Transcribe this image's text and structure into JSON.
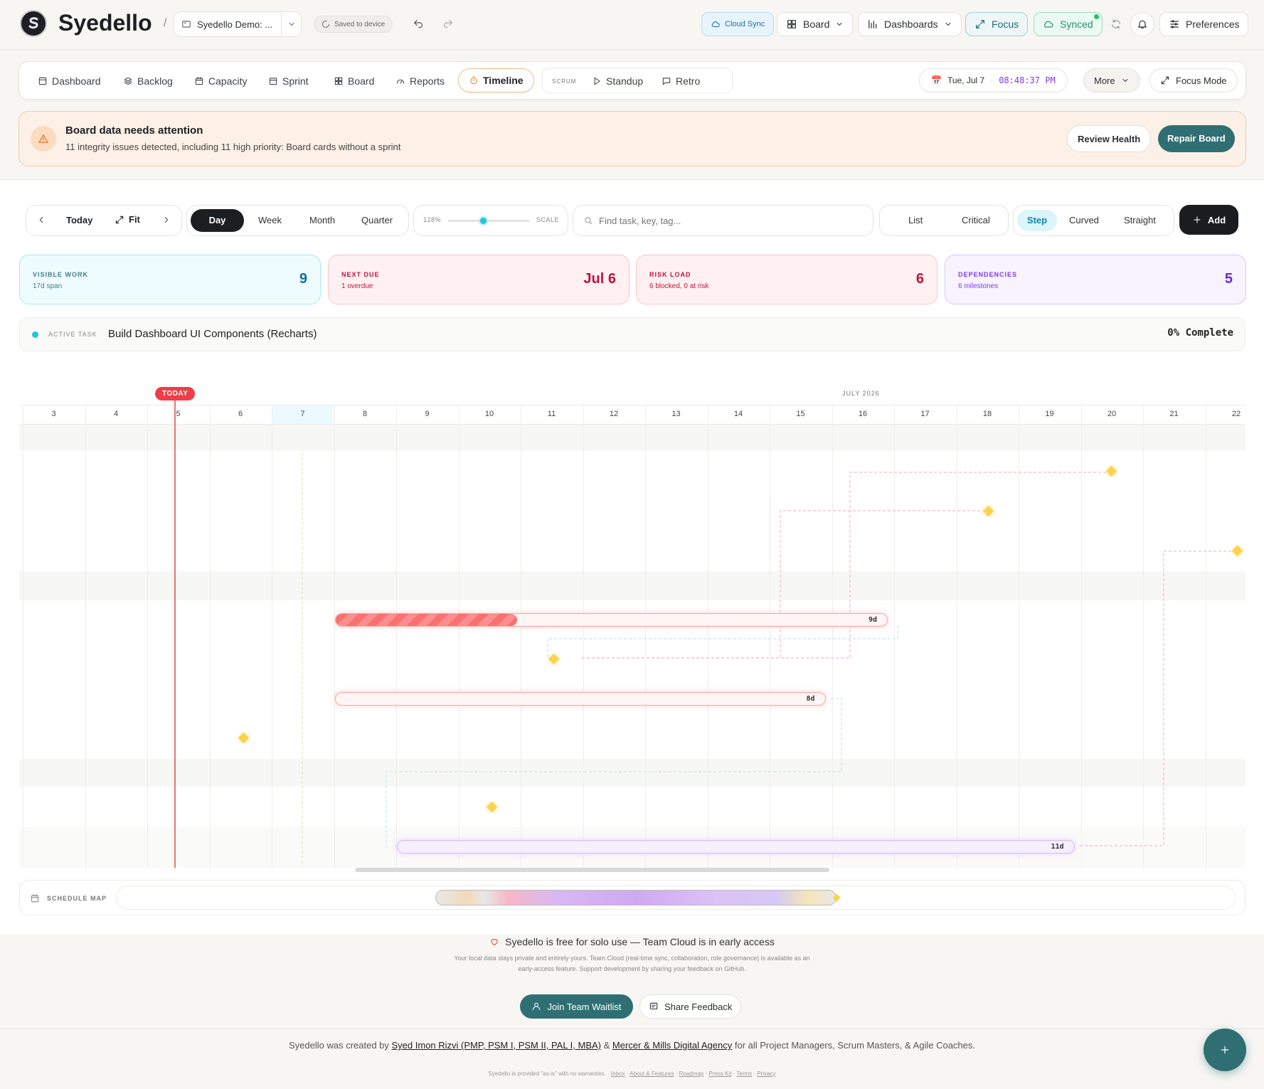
{
  "app": {
    "name": "Syedello",
    "project": "Syedello Demo: ...",
    "saved": "Saved to device"
  },
  "topbar": {
    "cloud_sync": "Cloud Sync",
    "board": "Board",
    "dashboards": "Dashboards",
    "focus": "Focus",
    "synced": "Synced",
    "preferences": "Preferences"
  },
  "nav": {
    "items": [
      "Dashboard",
      "Backlog",
      "Capacity",
      "Sprint",
      "Board",
      "Reports",
      "Timeline"
    ],
    "active": "Timeline",
    "scrum_label": "SCRUM",
    "scrum_items": [
      "Standup",
      "Retro"
    ],
    "date": "Tue, Jul 7",
    "time": "08:48:37 PM",
    "more": "More",
    "focus_mode": "Focus Mode"
  },
  "alert": {
    "title": "Board data needs attention",
    "text": "11 integrity issues detected, including 11 high priority: Board cards without a sprint",
    "review": "Review Health",
    "repair": "Repair Board"
  },
  "toolbar": {
    "today": "Today",
    "fit": "Fit",
    "scales": [
      "Day",
      "Week",
      "Month",
      "Quarter"
    ],
    "active_scale": "Day",
    "zoom": "128%",
    "zoom_value": 0.43,
    "scale_label": "SCALE",
    "search_placeholder": "Find task, key, tag...",
    "views": [
      "List",
      "Critical"
    ],
    "lines": [
      "Step",
      "Curved",
      "Straight"
    ],
    "active_line": "Step",
    "add": "Add"
  },
  "kpis": [
    {
      "label": "VISIBLE WORK",
      "sub": "17d span",
      "value": "9",
      "color": "#0e7490"
    },
    {
      "label": "NEXT DUE",
      "sub": "1 overdue",
      "value": "Jul 6",
      "color": "#be123c"
    },
    {
      "label": "RISK LOAD",
      "sub": "6 blocked, 0 at risk",
      "value": "6",
      "color": "#be123c"
    },
    {
      "label": "DEPENDENCIES",
      "sub": "6 milestones",
      "value": "5",
      "color": "#6d28d9"
    }
  ],
  "active_task": {
    "label": "ACTIVE TASK",
    "title": "Build Dashboard UI Components (Recharts)",
    "complete": "0% Complete"
  },
  "timeline": {
    "today_badge": "TODAY",
    "month": "JULY 2026",
    "days": [
      "3",
      "4",
      "5",
      "6",
      "7",
      "8",
      "9",
      "10",
      "11",
      "12",
      "13",
      "14",
      "15",
      "16",
      "17",
      "18",
      "19",
      "20",
      "21",
      "22"
    ],
    "bars": [
      {
        "start": 8,
        "end": 16,
        "label": "9d",
        "progress": 0.33
      },
      {
        "start": 8,
        "end": 15,
        "label": "8d",
        "progress": 0
      },
      {
        "start": 9,
        "end": 19,
        "label": "11d",
        "progress": 0
      }
    ]
  },
  "schedule_map": {
    "label": "SCHEDULE MAP"
  },
  "footer": {
    "headline": "Syedello is free for solo use — Team Cloud is in early access",
    "body1": "Your local data stays private and entirely yours. Team Cloud (real-time sync, collaboration, role governance) is available as an",
    "body2": "early-access feature. Support development by sharing your feedback on GitHub.",
    "waitlist": "Join Team Waitlist",
    "feedback": "Share Feedback",
    "credit_pre": "Syedello was created by ",
    "credit_name": "Syed Imon Rizvi (PMP, PSM I, PSM II, PAL I, MBA)",
    "credit_amp": " & ",
    "credit_agency": "Mercer & Mills Digital Agency",
    "credit_post": " for all Project Managers, Scrum Masters, & Agile Coaches.",
    "disclaimer": "Syedello is provided \"as-is\" with no warranties.",
    "links": [
      "Inbox",
      "About & Features",
      "Roadmap",
      "Press Kit",
      "Terms",
      "Privacy"
    ]
  }
}
